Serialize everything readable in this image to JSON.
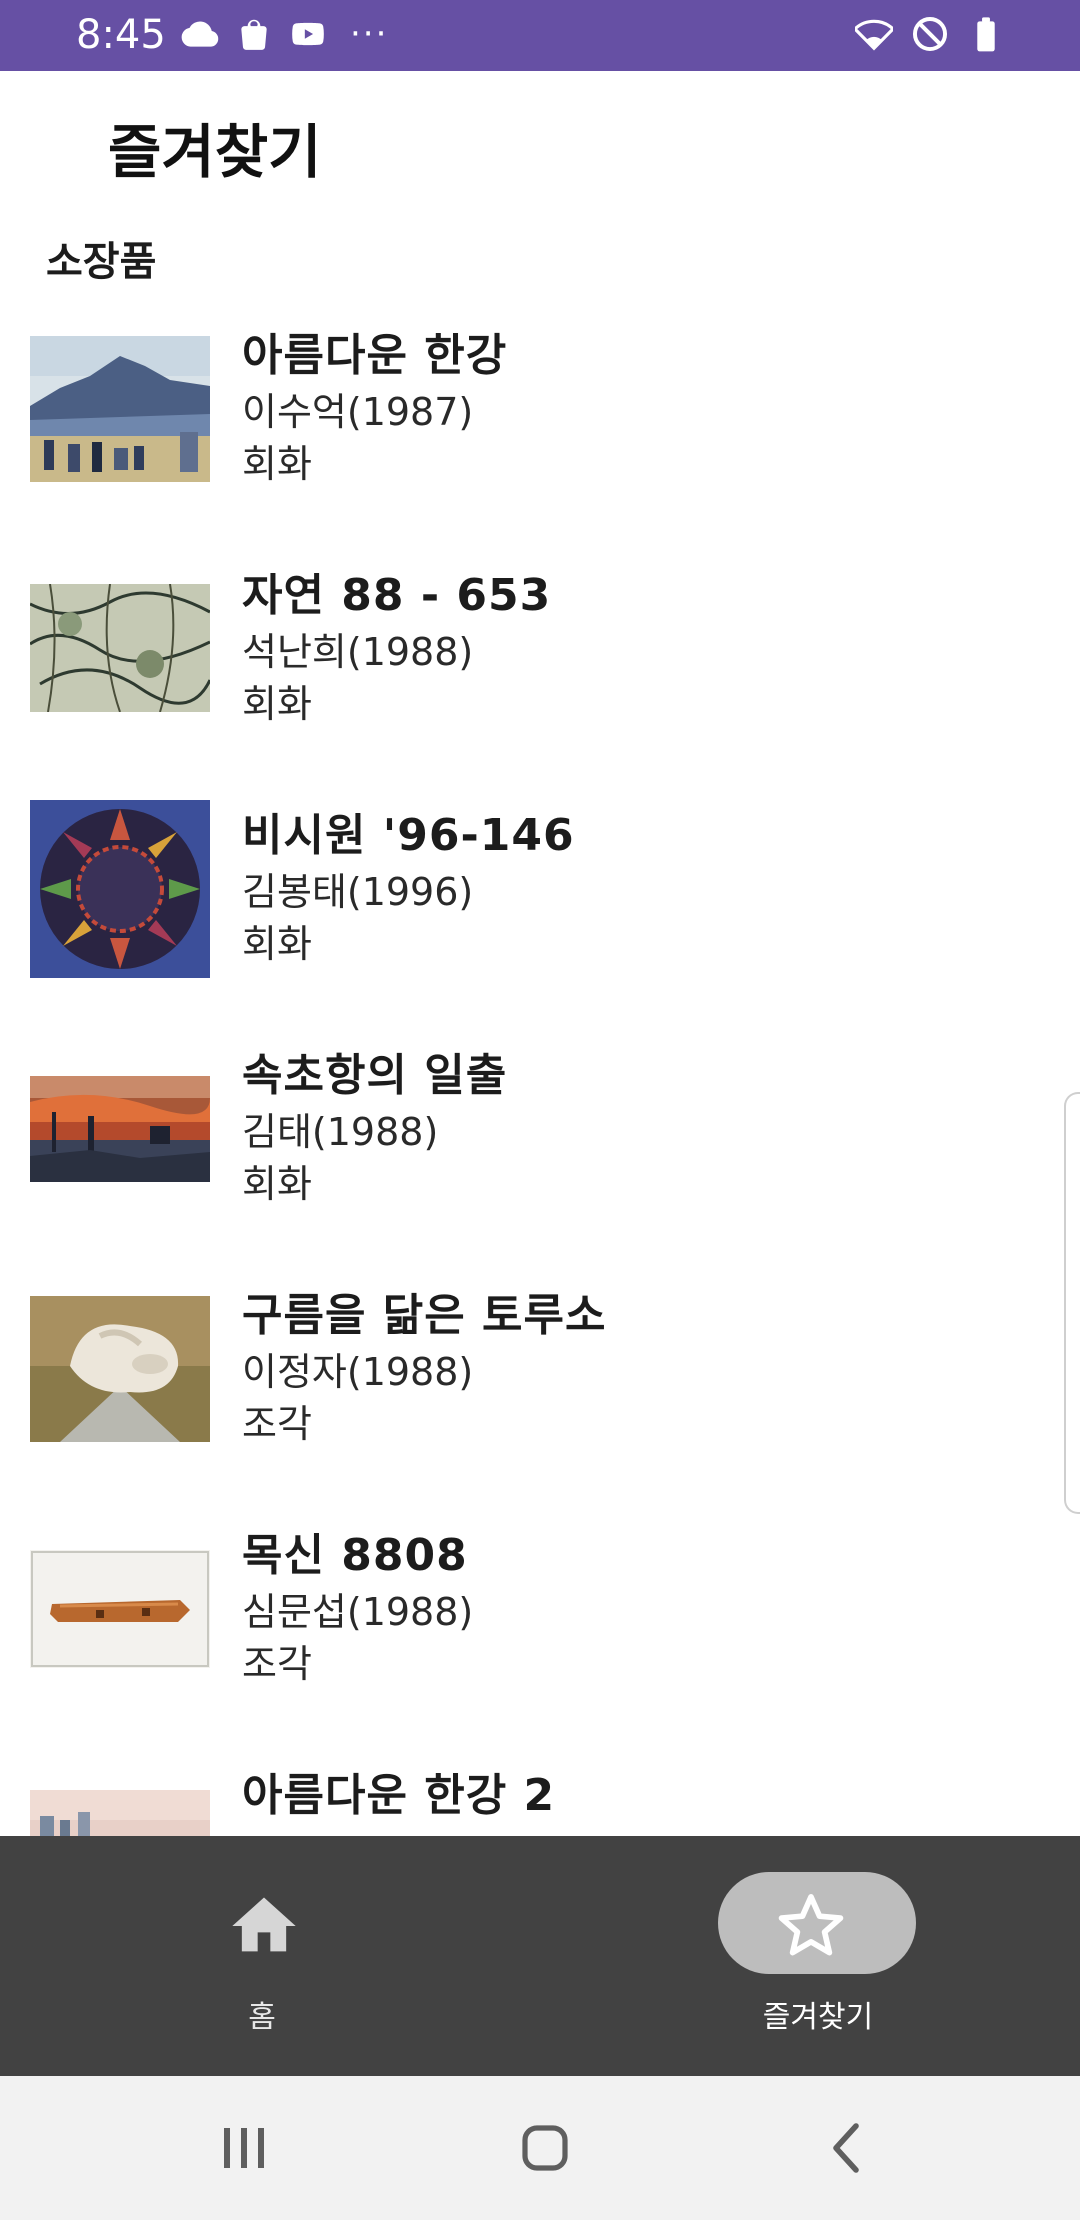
{
  "status_bar": {
    "time": "8:45",
    "left_icons": [
      "cloud-icon",
      "shopping-bag-icon",
      "youtube-icon"
    ],
    "overflow": "···",
    "right_icons": [
      "wifi-icon",
      "do-not-disturb-icon",
      "battery-icon"
    ],
    "background": "#6650a4"
  },
  "page": {
    "title": "즐겨찾기",
    "section": "소장품"
  },
  "items": [
    {
      "title": "아름다운 한강",
      "artist": "이수억(1987)",
      "category": "회화"
    },
    {
      "title": "자연 88 - 653",
      "artist": "석난희(1988)",
      "category": "회화"
    },
    {
      "title": "비시원 '96-146",
      "artist": "김봉태(1996)",
      "category": "회화"
    },
    {
      "title": "속초항의 일출",
      "artist": "김태(1988)",
      "category": "회화"
    },
    {
      "title": "구름을 닮은 토루소",
      "artist": "이정자(1988)",
      "category": "조각"
    },
    {
      "title": "목신 8808",
      "artist": "심문섭(1988)",
      "category": "조각"
    },
    {
      "title": "아름다운 한강 2",
      "artist": "",
      "category": ""
    }
  ],
  "bottom_nav": {
    "items": [
      {
        "label": "홈",
        "icon": "home-icon",
        "selected": false
      },
      {
        "label": "즐겨찾기",
        "icon": "star-icon",
        "selected": true
      }
    ],
    "background": "#424242",
    "indicator_color": "#bdbdbd"
  },
  "system_nav": {
    "buttons": [
      "recents-icon",
      "home-circle-icon",
      "back-icon"
    ]
  }
}
